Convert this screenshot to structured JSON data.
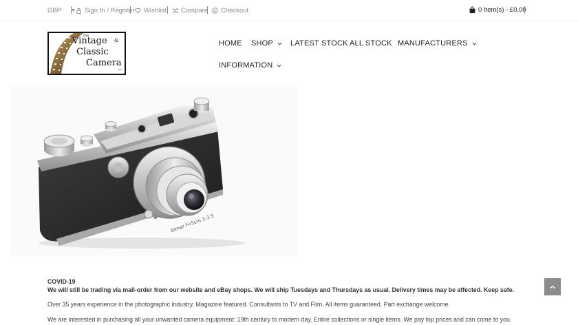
{
  "topbar": {
    "currency": "GBP",
    "signin_label": "Sign In / Register",
    "wishlist_label": "Wishlist",
    "compare_label": "Compare",
    "checkout_label": "Checkout",
    "cart_label": "0 Item(s) - £0.00"
  },
  "logo": {
    "line_the": "the",
    "line1": "Vintage",
    "amp": "&",
    "line2": "Classic",
    "line3": "Camera",
    "co": "co."
  },
  "nav": {
    "home": "HOME",
    "shop": "SHOP",
    "latest": "LATEST STOCK",
    "all": "ALL STOCK",
    "manufacturers": "MANUFACTURERS",
    "information": "INFORMATION"
  },
  "hero": {
    "lens_text": "Elmar f=5cm 1:3.5"
  },
  "content": {
    "covid_title": "COVID-19",
    "covid_message": "We will still be trading via mail-order from our website and eBay shops. We will ship Tuesdays and Thursdays as usual. Delivery times may be affected. Keep safe.",
    "para1": "Over 35 years experience in the photographic industry. Magazine featured. Consultants to TV and Film. All items guaranteed. Part exchange welcome.",
    "para2": "We are interested in purchasing all your unwanted camera equipment: 19th century to modern day. Entire collections or single items. We pay top prices and can come to you."
  },
  "colors": {
    "topbar_text": "#8a8a8a",
    "back_to_top_bg": "#8c8c8c"
  }
}
